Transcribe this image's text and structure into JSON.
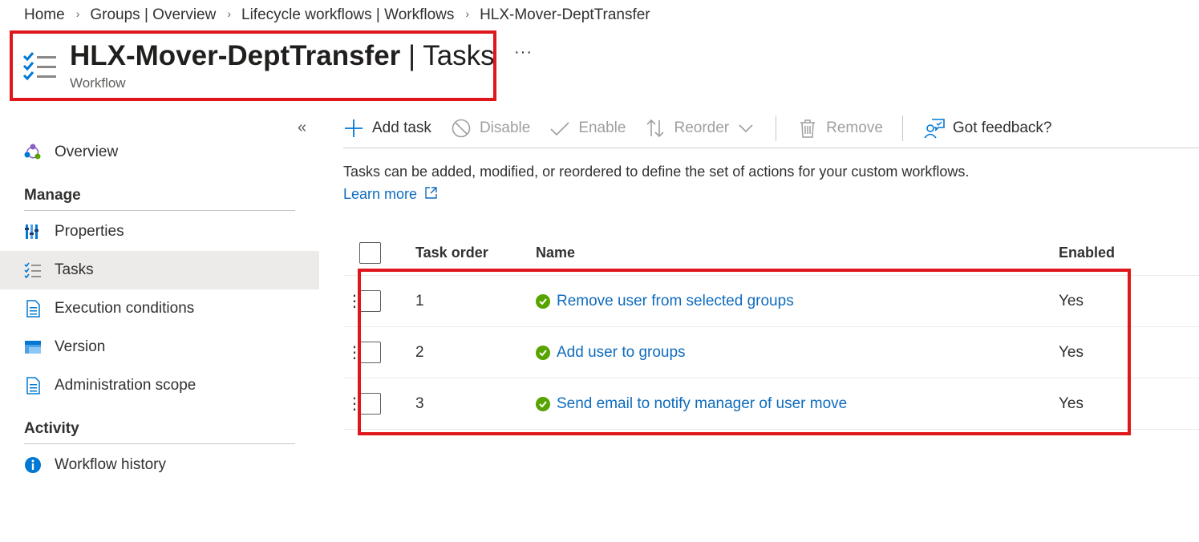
{
  "breadcrumb": [
    "Home",
    "Groups | Overview",
    "Lifecycle workflows | Workflows",
    "HLX-Mover-DeptTransfer"
  ],
  "header": {
    "title_name": "HLX-Mover-DeptTransfer",
    "title_suffix": " | Tasks",
    "subtitle": "Workflow",
    "more": "···"
  },
  "sidebar": {
    "collapse": "«",
    "overview": "Overview",
    "manage_heading": "Manage",
    "manage_items": [
      "Properties",
      "Tasks",
      "Execution conditions",
      "Version",
      "Administration scope"
    ],
    "active_item": "Tasks",
    "activity_heading": "Activity",
    "activity_items": [
      "Workflow history"
    ]
  },
  "toolbar": {
    "add_task": "Add task",
    "disable": "Disable",
    "enable": "Enable",
    "reorder": "Reorder",
    "remove": "Remove",
    "feedback": "Got feedback?"
  },
  "description": "Tasks can be added, modified, or reordered to define the set of actions for your custom workflows.",
  "learn_more": "Learn more",
  "table": {
    "columns": [
      "Task order",
      "Name",
      "Enabled"
    ],
    "rows": [
      {
        "order": "1",
        "name": "Remove user from selected groups",
        "enabled": "Yes"
      },
      {
        "order": "2",
        "name": "Add user to groups",
        "enabled": "Yes"
      },
      {
        "order": "3",
        "name": "Send email to notify manager of user move",
        "enabled": "Yes"
      }
    ]
  },
  "colors": {
    "link": "#0f6cbd",
    "highlight": "#e0161d",
    "success": "#57a300",
    "accent": "#0078d4"
  }
}
